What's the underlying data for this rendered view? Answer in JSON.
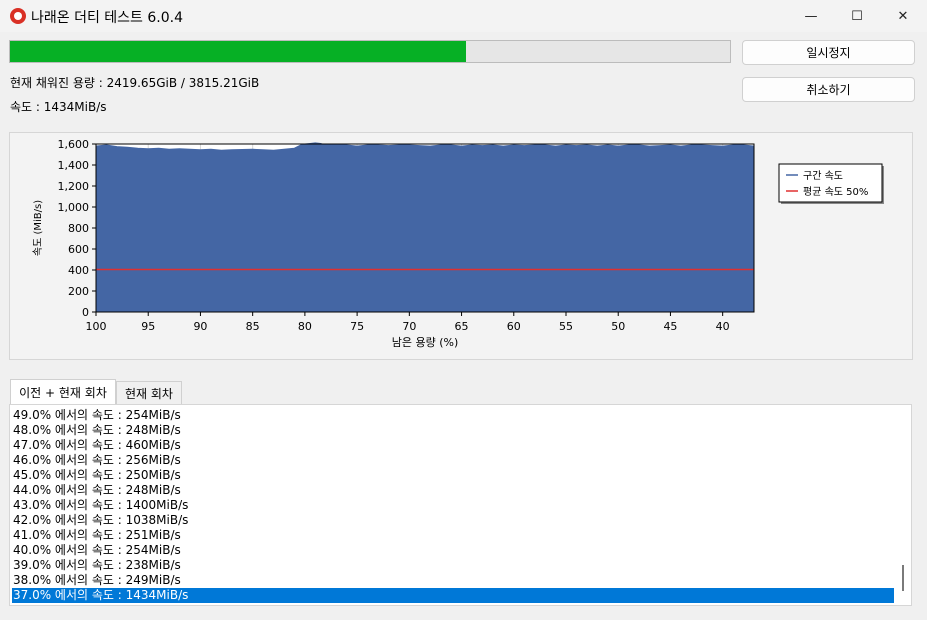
{
  "window": {
    "title": "나래온 더티 테스트 6.0.4",
    "controls": {
      "minimize": "—",
      "maximize": "☐",
      "close": "✕"
    }
  },
  "progress": {
    "percent": 63.4
  },
  "buttons": {
    "pause": "일시정지",
    "cancel": "취소하기"
  },
  "status": {
    "filled_capacity": "현재 채워진 용량 : 2419.65GiB / 3815.21GiB",
    "speed": "속도 : 1434MiB/s"
  },
  "chart_data": {
    "type": "area",
    "xlabel": "남은 용량 (%)",
    "ylabel": "속도 (MiB/s)",
    "xlim": [
      100,
      37
    ],
    "ylim": [
      0,
      1600
    ],
    "x_ticks": [
      "100",
      "95",
      "90",
      "85",
      "80",
      "75",
      "70",
      "65",
      "60",
      "55",
      "50",
      "45",
      "40"
    ],
    "y_ticks": [
      "0",
      "200",
      "400",
      "600",
      "800",
      "1,000",
      "1,200",
      "1,400",
      "1,600"
    ],
    "grid": true,
    "legend_placement": "right",
    "series": [
      {
        "name": "구간 속도",
        "color": "#4466a4",
        "x": [
          100,
          99,
          98,
          97,
          96,
          95,
          94,
          93,
          92,
          91,
          90,
          89,
          88,
          87,
          86,
          85,
          84,
          83,
          82,
          81,
          80.2,
          80,
          79.5,
          79,
          78.5,
          78,
          77.5,
          77,
          76,
          75,
          74,
          73,
          72,
          71,
          70,
          69,
          68,
          67,
          66,
          65,
          64,
          63,
          62,
          61,
          60,
          59,
          58,
          57,
          56,
          55,
          54,
          53,
          52,
          51,
          50,
          49,
          48,
          47,
          46,
          45,
          44,
          43,
          42,
          41,
          40,
          39,
          38,
          37
        ],
        "values": [
          1580,
          1590,
          1575,
          1570,
          1560,
          1555,
          1560,
          1550,
          1555,
          1550,
          1545,
          1550,
          1540,
          1545,
          1548,
          1550,
          1545,
          1540,
          1550,
          1560,
          1600,
          1600,
          1605,
          1610,
          1605,
          1590,
          1600,
          1590,
          1590,
          1580,
          1590,
          1590,
          1585,
          1590,
          1590,
          1585,
          1580,
          1590,
          1590,
          1580,
          1590,
          1585,
          1590,
          1580,
          1590,
          1585,
          1590,
          1590,
          1580,
          1590,
          1585,
          1590,
          1580,
          1590,
          1580,
          1590,
          1590,
          1580,
          1585,
          1590,
          1580,
          1590,
          1590,
          1585,
          1580,
          1590,
          1590,
          1580
        ]
      },
      {
        "name": "평균 속도 50%",
        "color": "#e03030",
        "x": [
          100,
          37
        ],
        "values": [
          405,
          405
        ]
      }
    ]
  },
  "tabs": [
    {
      "label": "이전 + 현재 회차"
    },
    {
      "label": "현재 회차"
    }
  ],
  "log": [
    "49.0% 에서의 속도 : 254MiB/s",
    "48.0% 에서의 속도 : 248MiB/s",
    "47.0% 에서의 속도 : 460MiB/s",
    "46.0% 에서의 속도 : 256MiB/s",
    "45.0% 에서의 속도 : 250MiB/s",
    "44.0% 에서의 속도 : 248MiB/s",
    "43.0% 에서의 속도 : 1400MiB/s",
    "42.0% 에서의 속도 : 1038MiB/s",
    "41.0% 에서의 속도 : 251MiB/s",
    "40.0% 에서의 속도 : 254MiB/s",
    "39.0% 에서의 속도 : 238MiB/s",
    "38.0% 에서의 속도 : 249MiB/s",
    "37.0% 에서의 속도 : 1434MiB/s"
  ]
}
